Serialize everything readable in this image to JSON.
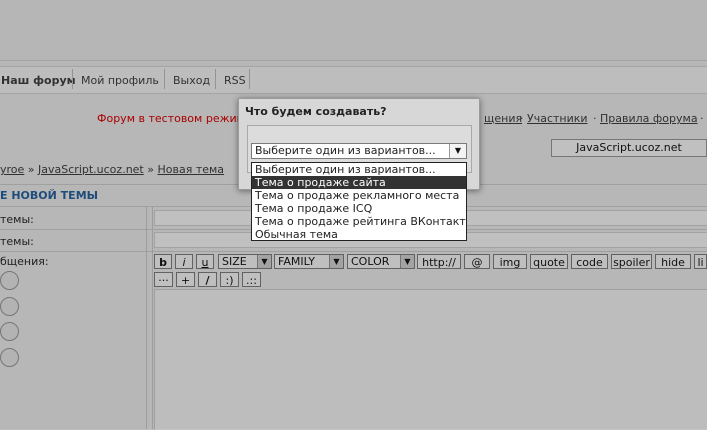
{
  "nav": {
    "items": [
      "Наш форум",
      "Мой профиль",
      "Выход",
      "RSS"
    ]
  },
  "info": {
    "red_text": "Форум в тестовом режим",
    "links_partial": "щения",
    "members": "Участники",
    "rules": "Правила форума",
    "sep": "·"
  },
  "forum_button": "JavaScript.ucoz.net",
  "breadcrumb": {
    "part1": "yroe",
    "sep": "»",
    "part2": "JavaScript.ucoz.net",
    "part3": "Новая тема"
  },
  "section_title": "Е НОВОЙ ТЕМЫ",
  "labels": {
    "title": "темы:",
    "desc": "темы:",
    "message": "бщения:"
  },
  "toolbar": {
    "bold": "b",
    "italic": "i",
    "underline": "u",
    "size": "SIZE",
    "family": "FAMILY",
    "color": "COLOR",
    "http": "http://",
    "at": "@",
    "img": "img",
    "quote": "quote",
    "code": "code",
    "spoiler": "spoiler",
    "hide": "hide",
    "li": "li",
    "dots": "···",
    "plus": "+",
    "slash": "/",
    "smile": ":)",
    "colon": ".::"
  },
  "modal": {
    "title": "Что будем создавать?",
    "select_value": "Выберите один из вариантов...",
    "options": [
      "Выберите один из вариантов...",
      "Тема о продаже сайта",
      "Тема о продаже рекламного места",
      "Тема о продаже ICQ",
      "Тема о продаже рейтинга ВКонтакте",
      "Обычная тема"
    ],
    "active_index": 1
  },
  "colors": {
    "accent_red": "#b00000",
    "section_blue": "#1f4f7f",
    "highlight": "#333333"
  }
}
